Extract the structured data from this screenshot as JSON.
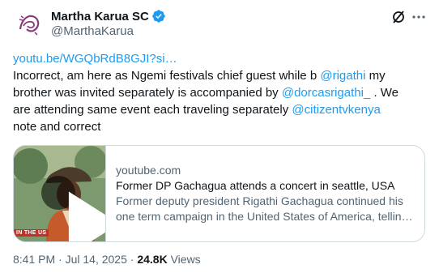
{
  "author": {
    "display_name": "Martha Karua SC",
    "handle": "@MarthaKarua"
  },
  "tweet": {
    "link_url": "youtu.be/WGQbRdB8GJI?si…",
    "line1": "Incorrect, am here as  Ngemi festivals chief guest  while b ",
    "mention1": "@rigathi",
    "line1_tail": " my",
    "line2": "brother was invited separately is accompanied by ",
    "mention2": "@dorcasrigathi_",
    "line2_tail": " . We",
    "line3": "are attending same event each traveling separately ",
    "mention3": "@citizentvkenya",
    "line4": "note and correct"
  },
  "card": {
    "domain": "youtube.com",
    "title": "Former DP Gachagua attends a concert in seattle, USA",
    "description": "Former deputy president Rigathi Gachagua continued his one term campaign in the United States of America, tellin…",
    "thumb_caption": "IN THE US"
  },
  "meta": {
    "time": "8:41 PM",
    "separator1": " · ",
    "date": "Jul 14, 2025",
    "separator2": " · ",
    "views_count": "24.8K",
    "views_label": " Views"
  },
  "colors": {
    "link": "#1d9bf0",
    "verified": "#1d9bf0",
    "muted": "#536471"
  },
  "icons": [
    "avatar-logo",
    "verified-badge-icon",
    "grok-icon",
    "more-icon",
    "play-icon"
  ]
}
